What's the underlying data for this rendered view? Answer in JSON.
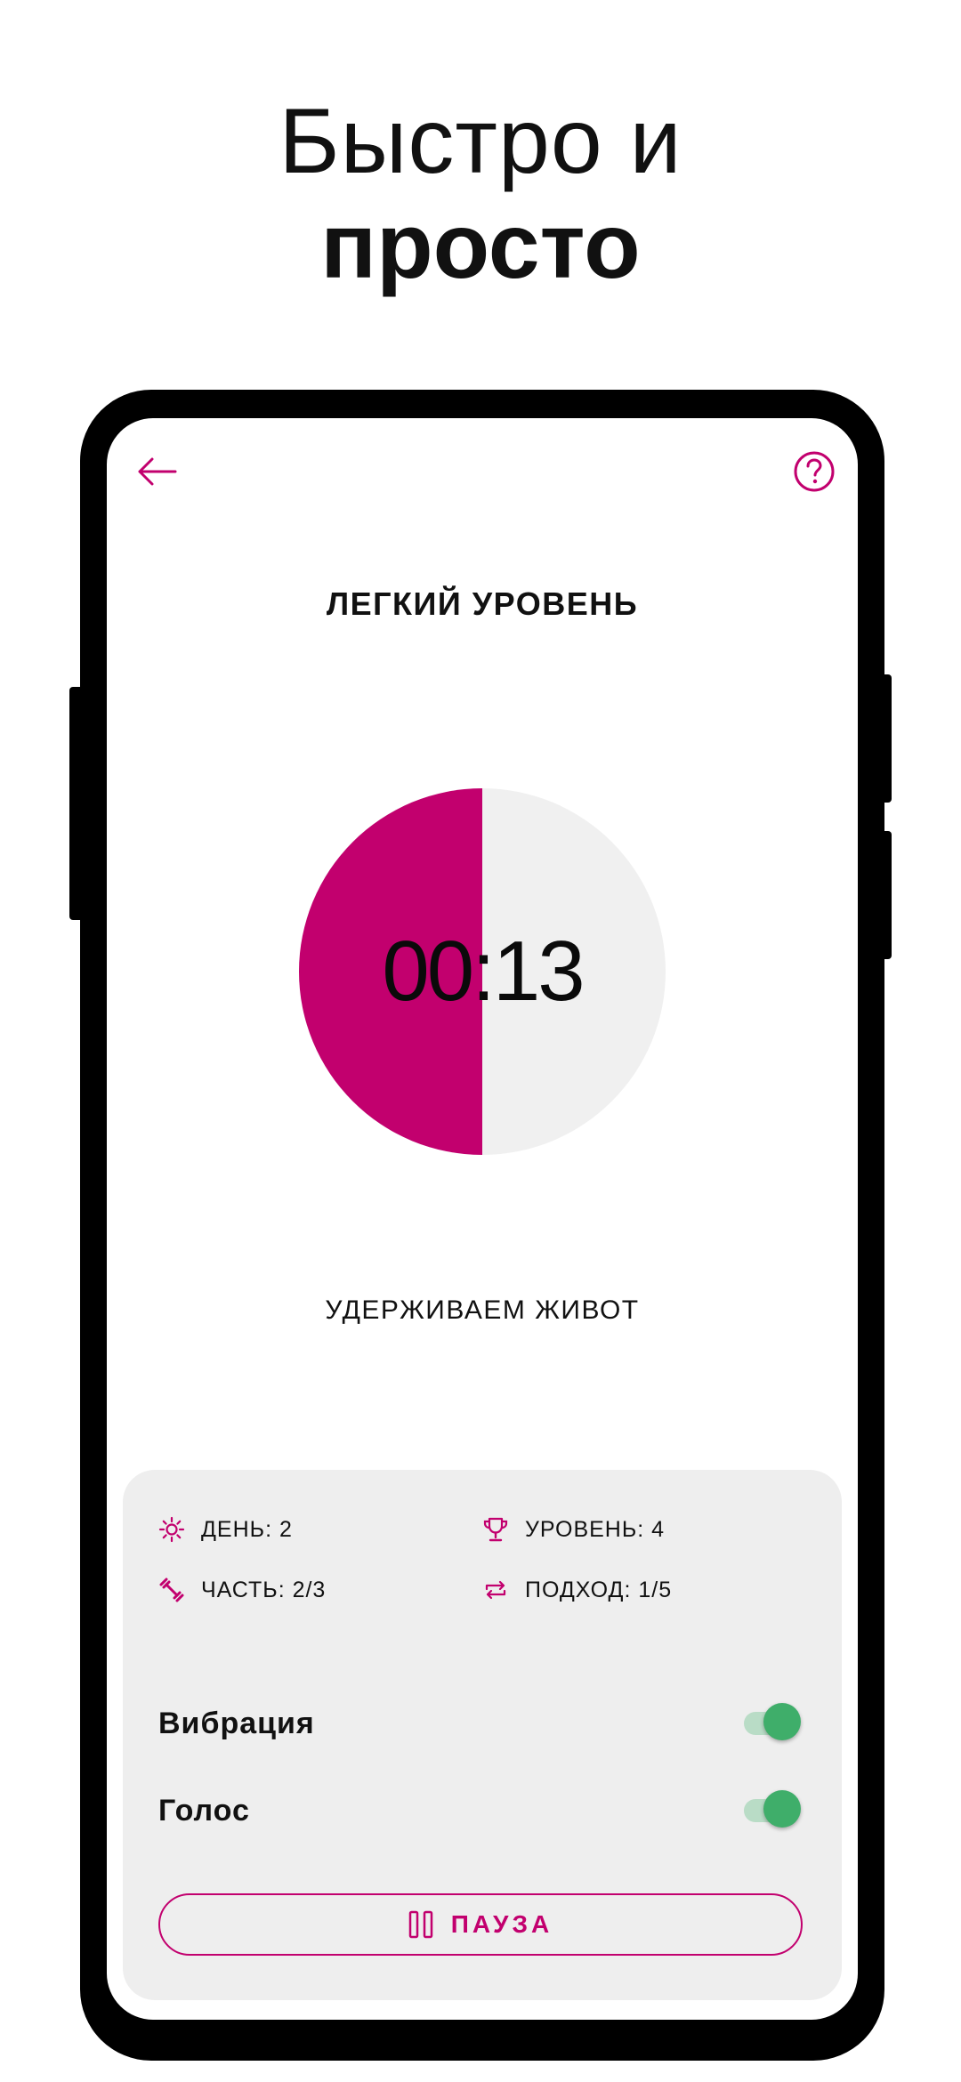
{
  "headline": {
    "line1": "Быстро и",
    "line2": "просто"
  },
  "screen": {
    "level_title": "ЛЕГКИЙ УРОВЕНЬ",
    "timer": {
      "text": "00:13",
      "progress_fraction": 0.5,
      "fill_color": "#c2006e",
      "track_color": "#f0f0f0"
    },
    "exercise_name": "УДЕРЖИВАЕМ ЖИВОТ",
    "stats": {
      "day": "ДЕНЬ: 2",
      "level": "УРОВЕНЬ: 4",
      "part": "ЧАСТЬ: 2/3",
      "set": "ПОДХОД: 1/5"
    },
    "settings": {
      "vibration": {
        "label": "Вибрация",
        "enabled": true
      },
      "voice": {
        "label": "Голос",
        "enabled": true
      }
    },
    "pause_button": {
      "label": "ПАУЗА"
    }
  },
  "icons": {
    "back": "arrow-left-icon",
    "help": "question-circle-icon",
    "day": "sun-icon",
    "level": "trophy-icon",
    "part": "dumbbell-icon",
    "set": "repeat-icon",
    "pause": "pause-icon"
  },
  "colors": {
    "accent": "#c2006e",
    "toggle_on": "#3fae6a",
    "panel_bg": "#eeeeee"
  }
}
